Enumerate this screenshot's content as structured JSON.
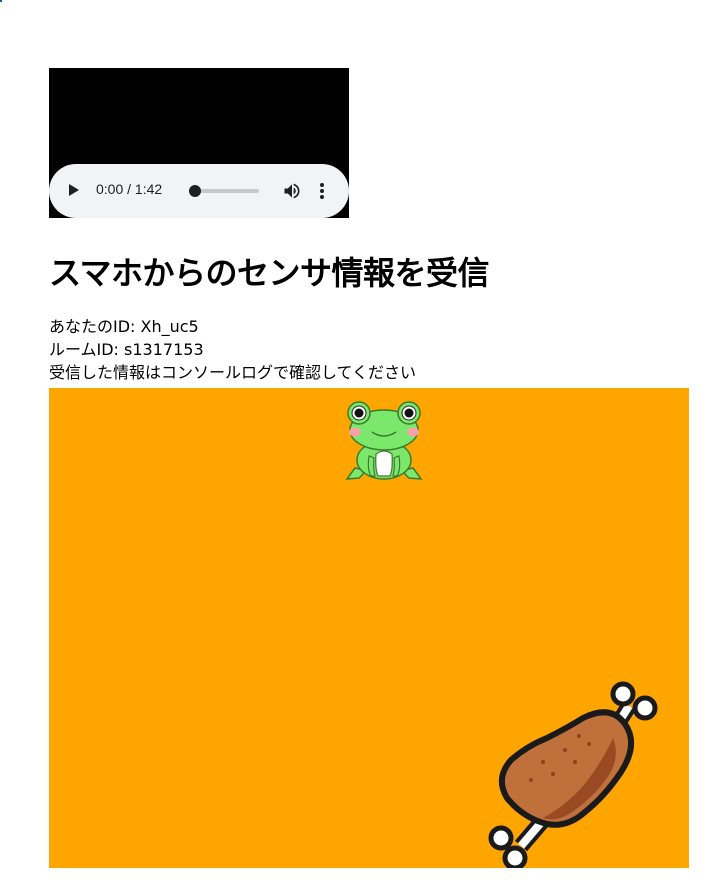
{
  "audio_player": {
    "time_display": "0:00 / 1:42",
    "progress": 0.0
  },
  "page": {
    "title": "スマホからのセンサ情報を受信",
    "your_id_line": "あなたのID: Xh_uc5",
    "room_id_line": "ルームID: s1317153",
    "instruction_line": "受信した情報はコンソールログで確認してください"
  },
  "game": {
    "background_color": "#ffa500",
    "player_sprite": "frog-icon",
    "item_sprite": "meat-icon"
  }
}
